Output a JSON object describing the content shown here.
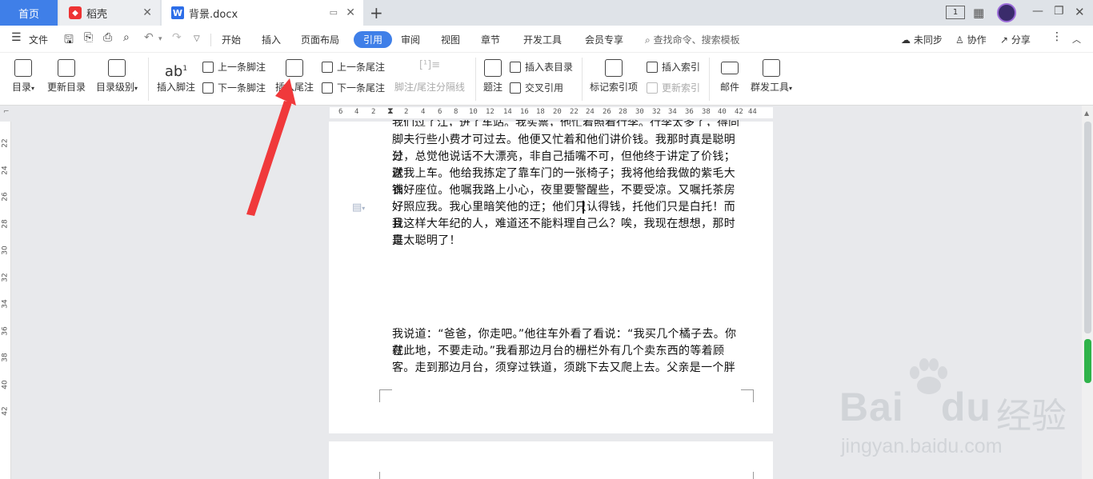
{
  "tabs": {
    "home": "首页",
    "daoke": "稻壳",
    "doc": "背景.docx",
    "doc_logo": "W"
  },
  "window": {
    "page_indicator": "1"
  },
  "menu": {
    "file": "文件",
    "items": [
      "开始",
      "插入",
      "页面布局",
      "引用",
      "审阅",
      "视图",
      "章节",
      "开发工具",
      "会员专享"
    ],
    "search_placeholder": "查找命令、搜索模板",
    "sync": "未同步",
    "collab": "协作",
    "share": "分享"
  },
  "ribbon": {
    "toc": "目录",
    "update_toc": "更新目录",
    "toc_level": "目录级别",
    "insert_footnote": "插入脚注",
    "footnote_icon_text": "ab",
    "prev_footnote": "上一条脚注",
    "next_footnote": "下一条脚注",
    "insert_endnote": "插入尾注",
    "prev_endnote": "上一条尾注",
    "next_endnote": "下一条尾注",
    "separator": "脚注/尾注分隔线",
    "caption": "题注",
    "insert_table_of_figures": "插入表目录",
    "cross_reference": "交叉引用",
    "mark_index": "标记索引项",
    "insert_index": "插入索引",
    "update_index": "更新索引",
    "mail": "邮件",
    "mass_tools": "群发工具"
  },
  "ruler": {
    "h_ticks": [
      "6",
      "4",
      "2",
      "2",
      "4",
      "6",
      "8",
      "10",
      "12",
      "14",
      "16",
      "18",
      "20",
      "22",
      "24",
      "26",
      "28",
      "30",
      "32",
      "34",
      "36",
      "38",
      "40",
      "42",
      "44"
    ],
    "v_ticks": [
      "22",
      "24",
      "26",
      "28",
      "30",
      "32",
      "34",
      "36",
      "38",
      "40",
      "42"
    ]
  },
  "document": {
    "lines_top": [
      "脚夫行些小费才可过去。他便又忙着和他们讲价钱。我那时真是聪明过",
      "分，总觉他说话不大漂亮，非自己插嘴不可，但他终于讲定了价钱；就",
      "送我上车。他给我拣定了靠车门的一张椅子；我将他给我做的紫毛大衣",
      "铺好座位。他嘱我路上小心，夜里要警醒些，不要受凉。又嘱托茶房好",
      "好照应我。我心里暗笑他的迂；他们只认得钱，托他们只是白托！而且",
      "我这样大年纪的人，难道还不能料理自己么？唉，我现在想想，那时真",
      "是太聪明了！"
    ],
    "lines_bottom": [
      "我说道：“爸爸，你走吧。”他往车外看了看说：“我买几个橘子去。你就",
      "在此地，不要走动。”我看那边月台的栅栏外有几个卖东西的等着顾",
      "客。走到那边月台，须穿过铁道，须跳下去又爬上去。父亲是一个胖"
    ]
  },
  "watermark": {
    "brand": "Bai",
    "brand2": "du",
    "cn": "经验",
    "url": "jingyan.baidu.com"
  },
  "colors": {
    "accent": "#3f7fe8",
    "arrow": "#f0393b"
  }
}
